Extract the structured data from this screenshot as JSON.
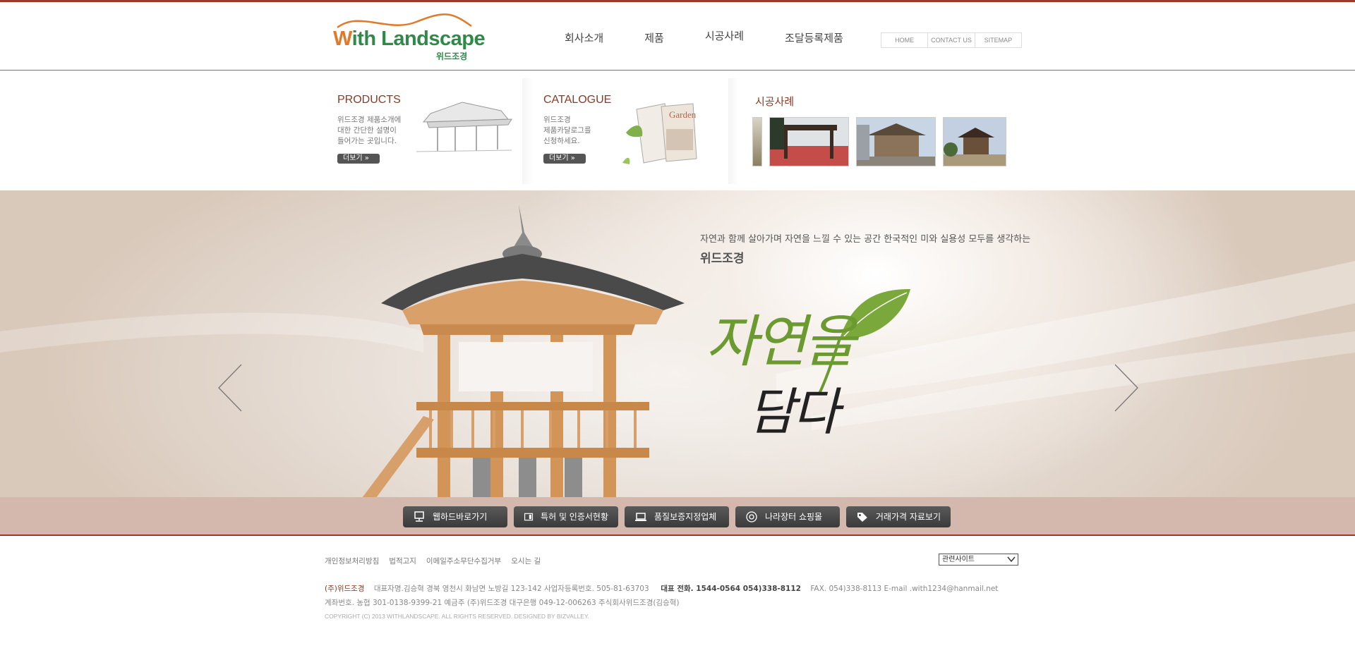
{
  "header": {
    "logo_text_w": "W",
    "logo_text_rest": "ith Landscape",
    "logo_sub": "위드조경",
    "nav": [
      "회사소개",
      "제품",
      "시공사례",
      "조달등록제품"
    ],
    "util": [
      "HOME",
      "CONTACT US",
      "SITEMAP"
    ]
  },
  "features": {
    "products": {
      "title": "PRODUCTS",
      "desc": "위드조경 제품소개에\n대한 간단한 설명이\n들어가는 곳입니다.",
      "more": "더보기 »"
    },
    "catalogue": {
      "title": "CATALOGUE",
      "desc": "위드조경\n제품카달로그를\n신청하세요.",
      "more": "더보기 »",
      "book_text": "Garden"
    },
    "cases": {
      "title": "시공사례"
    }
  },
  "hero": {
    "tagline": "자연과 함께 살아가며 자연을 느낄 수 있는 공간 한국적인 미와 실용성 모두를 생각하는",
    "brand": "위드조경",
    "calligraphy_1": "자연을",
    "calligraphy_2": "담다"
  },
  "quick_links": [
    "웹하드바로가기",
    "특허 및 인증서현황",
    "품질보증지정업체",
    "나라장터 쇼핑몰",
    "거래가격 자료보기"
  ],
  "footer": {
    "nav": [
      "개인정보처리방침",
      "법적고지",
      "이메일주소무단수집거부",
      "오시는 길"
    ],
    "select": "관련사이트",
    "company": "(주)위드조경",
    "line1_a": "대표자명.김승혁    경북 영천시 화남면 노방길 123-142    사업자등록번호. 505-81-63703",
    "line1_tel": "대표 전화. 1544-0564    054)338-8112",
    "line1_b": "FAX. 054)338-8113    E-mail .with1234@hanmail.net",
    "line2": "계좌번호. 농협 301-0138-9399-21    예금주 (주)위드조경    대구은행 049-12-006263    주식회사위드조경(김승혁)",
    "copyright": "COPYRIGHT (C) 2013 WITHLANDSCAPE.  ALL RIGHTS RESERVED.  DESIGNED BY BIZVALLEY."
  },
  "colors": {
    "accent": "#9b3a2a",
    "logo_green": "#2f8a4a",
    "logo_orange": "#e07a2a",
    "quick_bar": "#d5b8ad"
  }
}
